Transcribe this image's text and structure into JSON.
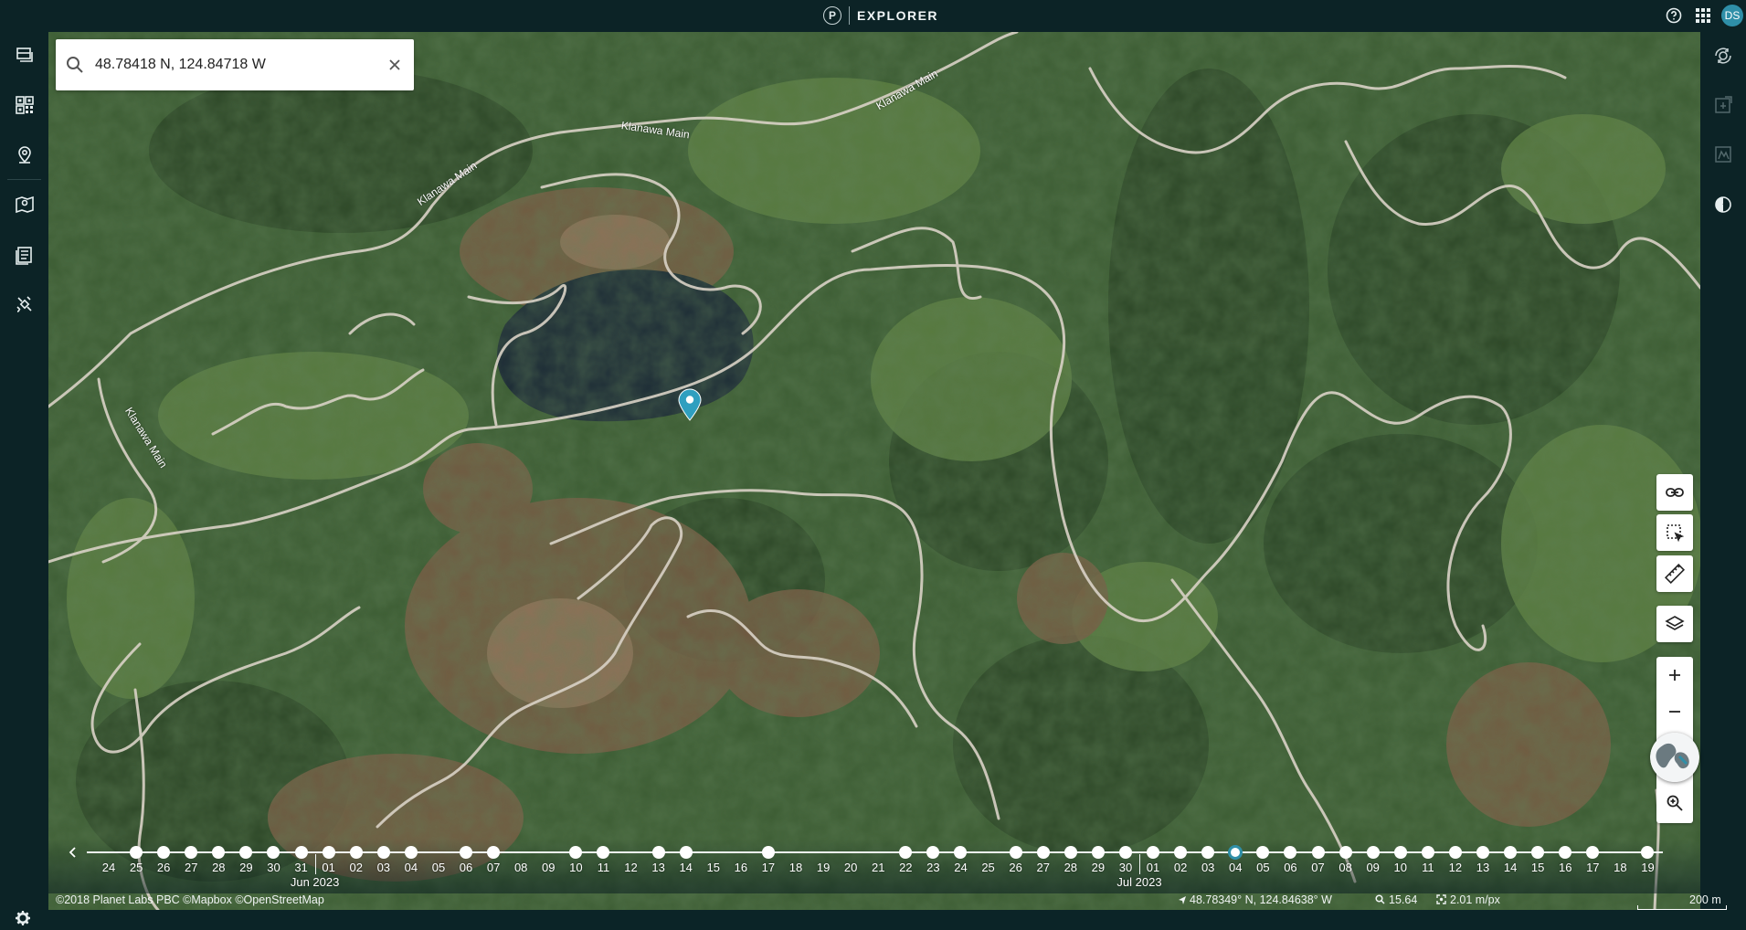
{
  "app": {
    "title": "EXPLORER",
    "logo_letter": "P",
    "user_initials": "DS"
  },
  "topbar": {
    "icons": [
      "help-icon",
      "apps-grid-icon"
    ]
  },
  "sidebar_left": {
    "items": [
      "layers-stack-icon",
      "qr-grid-icon",
      "location-pin-icon",
      "map-pin-icon",
      "list-icon",
      "satellite-icon"
    ],
    "settings_icon": "gear-icon"
  },
  "sidebar_right": {
    "items": [
      "timelapse-icon",
      "export-icon",
      "analytics-icon",
      "compare-icon"
    ]
  },
  "search": {
    "value": "48.78418 N, 124.84718 W",
    "placeholder": "Search"
  },
  "road_labels": [
    "Klanawa Main",
    "Klanawa Main",
    "Klanawa Main",
    "Klanawa Main"
  ],
  "map_tools": {
    "buttons": [
      "link-icon",
      "select-area-icon",
      "ruler-icon",
      "layers-icon"
    ],
    "zoom_in": "+",
    "zoom_out": "−",
    "zoom_to": "zoom-search-icon"
  },
  "timeline": {
    "days": [
      "24",
      "25",
      "26",
      "27",
      "28",
      "29",
      "30",
      "31",
      "01",
      "02",
      "03",
      "04",
      "05",
      "06",
      "07",
      "08",
      "09",
      "10",
      "11",
      "12",
      "13",
      "14",
      "15",
      "16",
      "17",
      "18",
      "19",
      "20",
      "21",
      "22",
      "23",
      "24",
      "25",
      "26",
      "27",
      "28",
      "29",
      "30",
      "01",
      "02",
      "03",
      "04",
      "05",
      "06",
      "07",
      "08",
      "09",
      "10",
      "11",
      "12",
      "13",
      "14",
      "15",
      "16",
      "17",
      "18",
      "19"
    ],
    "dots": [
      false,
      true,
      true,
      true,
      true,
      true,
      true,
      true,
      true,
      true,
      true,
      true,
      false,
      true,
      true,
      false,
      false,
      true,
      true,
      false,
      true,
      true,
      false,
      false,
      true,
      false,
      false,
      false,
      false,
      true,
      true,
      true,
      false,
      true,
      true,
      true,
      true,
      true,
      true,
      true,
      true,
      true,
      true,
      true,
      true,
      true,
      true,
      true,
      true,
      true,
      true,
      true,
      true,
      true,
      true,
      false,
      true
    ],
    "selected_index": 41,
    "months": [
      {
        "label": "Jun 2023",
        "day_index": 8
      },
      {
        "label": "Jul 2023",
        "day_index": 38
      }
    ],
    "prev_label": "‹"
  },
  "status": {
    "copyright": "©2018 Planet Labs PBC ©Mapbox ©OpenStreetMap",
    "coordinates": "48.78349° N, 124.84638° W",
    "zoom": "15.64",
    "resolution": "2.01 m/px",
    "scale": "200 m"
  },
  "colors": {
    "accent": "#2f8fa8",
    "chrome": "#0c2326",
    "forest": "#3d5a33"
  }
}
